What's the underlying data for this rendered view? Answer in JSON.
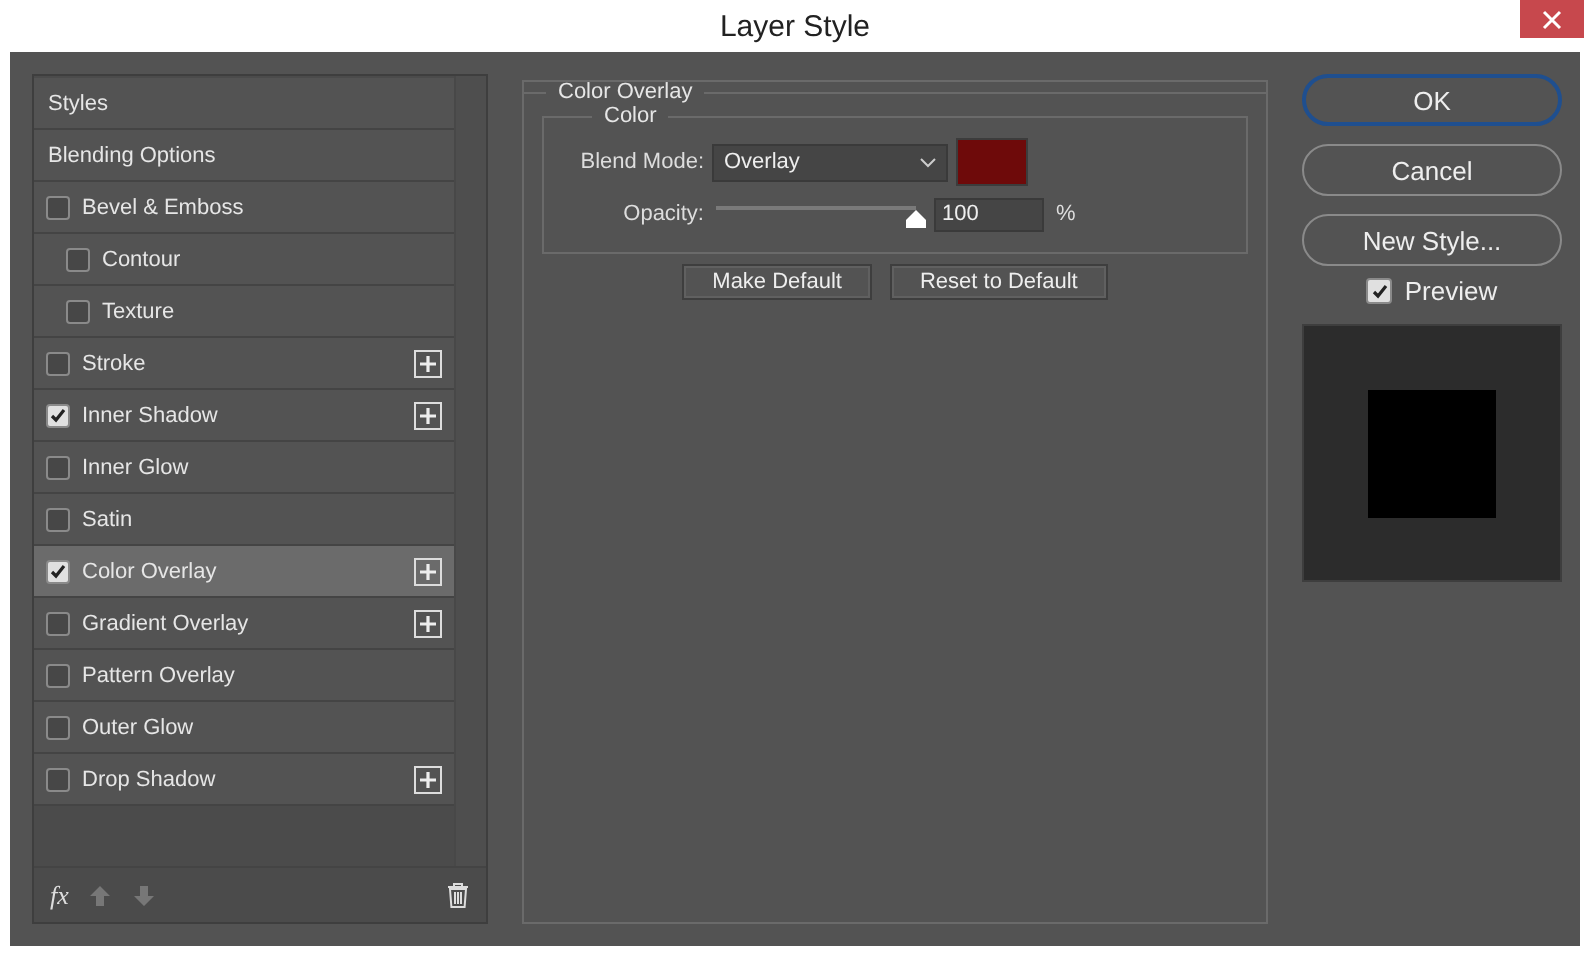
{
  "window": {
    "title": "Layer Style"
  },
  "styles": [
    {
      "label": "Styles",
      "kind": "heading",
      "selected": false
    },
    {
      "label": "Blending Options",
      "kind": "heading",
      "selected": false
    },
    {
      "label": "Bevel & Emboss",
      "kind": "effect",
      "checked": false,
      "selected": false,
      "addable": false,
      "children": [
        {
          "label": "Contour",
          "kind": "effect",
          "checked": false,
          "selected": false,
          "addable": false
        },
        {
          "label": "Texture",
          "kind": "effect",
          "checked": false,
          "selected": false,
          "addable": false
        }
      ]
    },
    {
      "label": "Stroke",
      "kind": "effect",
      "checked": false,
      "selected": false,
      "addable": true
    },
    {
      "label": "Inner Shadow",
      "kind": "effect",
      "checked": true,
      "selected": false,
      "addable": true
    },
    {
      "label": "Inner Glow",
      "kind": "effect",
      "checked": false,
      "selected": false,
      "addable": false
    },
    {
      "label": "Satin",
      "kind": "effect",
      "checked": false,
      "selected": false,
      "addable": false
    },
    {
      "label": "Color Overlay",
      "kind": "effect",
      "checked": true,
      "selected": true,
      "addable": true
    },
    {
      "label": "Gradient Overlay",
      "kind": "effect",
      "checked": false,
      "selected": false,
      "addable": true
    },
    {
      "label": "Pattern Overlay",
      "kind": "effect",
      "checked": false,
      "selected": false,
      "addable": false
    },
    {
      "label": "Outer Glow",
      "kind": "effect",
      "checked": false,
      "selected": false,
      "addable": false
    },
    {
      "label": "Drop Shadow",
      "kind": "effect",
      "checked": false,
      "selected": false,
      "addable": true
    }
  ],
  "footer": {
    "fx": "fx"
  },
  "panel": {
    "group": "Color Overlay",
    "subgroup": "Color",
    "blend_mode": {
      "label": "Blend Mode:",
      "value": "Overlay"
    },
    "color": "#6e0a0a",
    "opacity": {
      "label": "Opacity:",
      "level": 1.0,
      "value": "100",
      "unit": "%"
    },
    "buttons": [
      "Make Default",
      "Reset to Default"
    ]
  },
  "actions": [
    {
      "label": "OK",
      "default": true
    },
    {
      "label": "Cancel",
      "default": false
    },
    {
      "label": "New Style...",
      "default": false
    }
  ],
  "preview": {
    "label": "Preview",
    "checked": true
  }
}
